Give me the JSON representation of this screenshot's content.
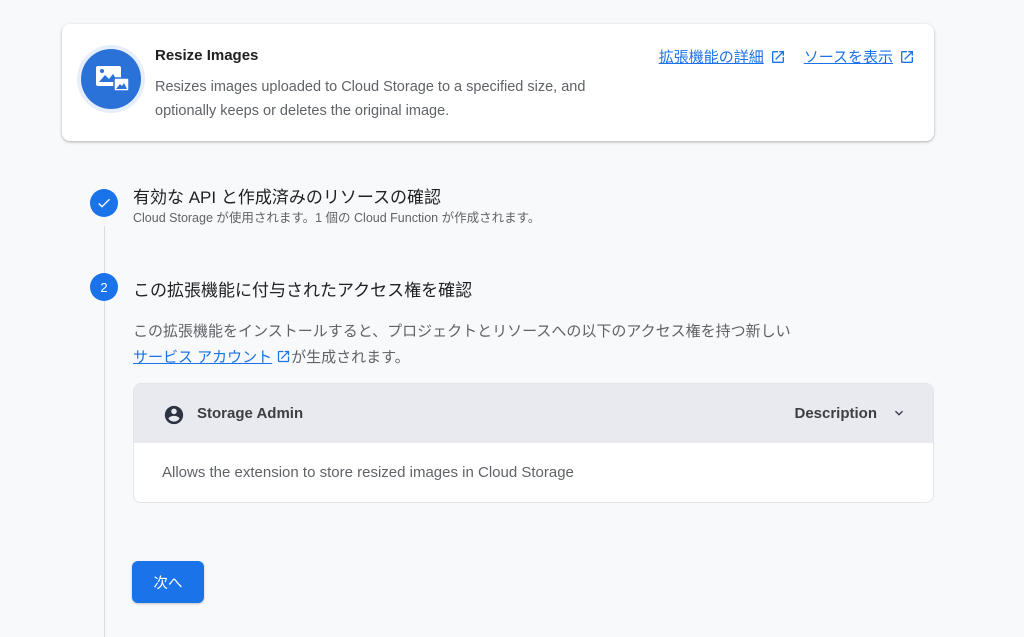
{
  "extension": {
    "title": "Resize Images",
    "description": "Resizes images uploaded to Cloud Storage to a specified size, and optionally keeps or deletes the original image.",
    "logo_icon": "image-resize-icon",
    "links": [
      {
        "label": "拡張機能の詳細",
        "icon": "open-in-new-icon"
      },
      {
        "label": "ソースを表示",
        "icon": "open-in-new-icon"
      }
    ]
  },
  "steps": [
    {
      "status": "done",
      "icon": "check-icon",
      "title": "有効な API と作成済みのリソースの確認",
      "subtitle": "Cloud Storage が使用されます。1 個の Cloud Function が作成されます。"
    },
    {
      "status": "active",
      "number": "2",
      "title": "この拡張機能に付与されたアクセス権を確認",
      "description_before": "この拡張機能をインストールすると、プロジェクトとリソースへの以下のアクセス権を持つ新しい",
      "service_account_link": "サービス アカウント",
      "description_after": "が生成されます。",
      "permission": {
        "role": "Storage Admin",
        "role_icon": "account-circle-icon",
        "toggle_label": "Description",
        "toggle_icon": "chevron-down-icon",
        "body": "Allows the extension to store resized images in Cloud Storage"
      },
      "next_button": "次へ"
    }
  ],
  "colors": {
    "accent": "#1a73e8",
    "background": "#f8f9fa",
    "panel_header": "#e8eaf0"
  }
}
